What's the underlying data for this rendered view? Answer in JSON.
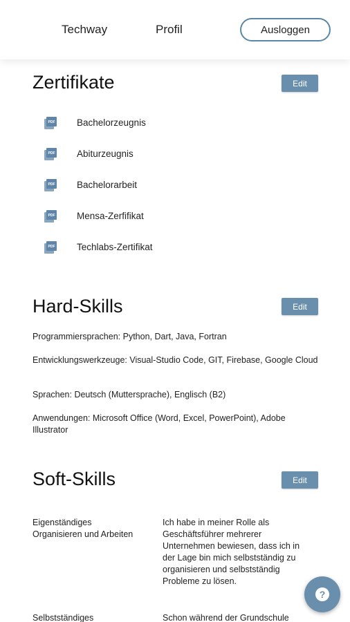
{
  "nav": {
    "techway": "Techway",
    "profil": "Profil",
    "logout": "Ausloggen"
  },
  "zertifikate": {
    "title": "Zertifikate",
    "edit": "Edit",
    "items": [
      {
        "label": "Bachelorzeugnis",
        "icon": "pdf-icon"
      },
      {
        "label": "Abiturzeugnis",
        "icon": "pdf-icon"
      },
      {
        "label": "Bachelorarbeit",
        "icon": "pdf-icon"
      },
      {
        "label": "Mensa-Zerfifikat",
        "icon": "pdf-icon"
      },
      {
        "label": "Techlabs-Zertifikat",
        "icon": "pdf-icon"
      }
    ]
  },
  "hardskills": {
    "title": "Hard-Skills",
    "edit": "Edit",
    "lines": [
      "Programmiersprachen: Python, Dart, Java, Fortran",
      "Entwicklungswerkzeuge: Visual-Studio Code, GIT, Firebase, Google Cloud",
      "Sprachen: Deutsch (Muttersprache), Englisch (B2)",
      "Anwendungen: Microsoft Office (Word, Excel, PowerPoint), Adobe Illustrator"
    ]
  },
  "softskills": {
    "title": "Soft-Skills",
    "edit": "Edit",
    "rows": [
      {
        "skill": "Eigenständiges Organisieren und Arbeiten",
        "description": "Ich habe in meiner Rolle als Geschäftsführer mehrerer Unternehmen bewiesen, dass ich in der Lage bin mich selbstständig zu organisieren und selbstständig Probleme zu lösen."
      },
      {
        "skill": "Selbstständiges",
        "description": "Schon während der Grundschule"
      }
    ]
  },
  "colors": {
    "accent": "#6a8fac",
    "logout_border": "#5a87a6"
  },
  "help": {
    "icon": "question-icon"
  }
}
